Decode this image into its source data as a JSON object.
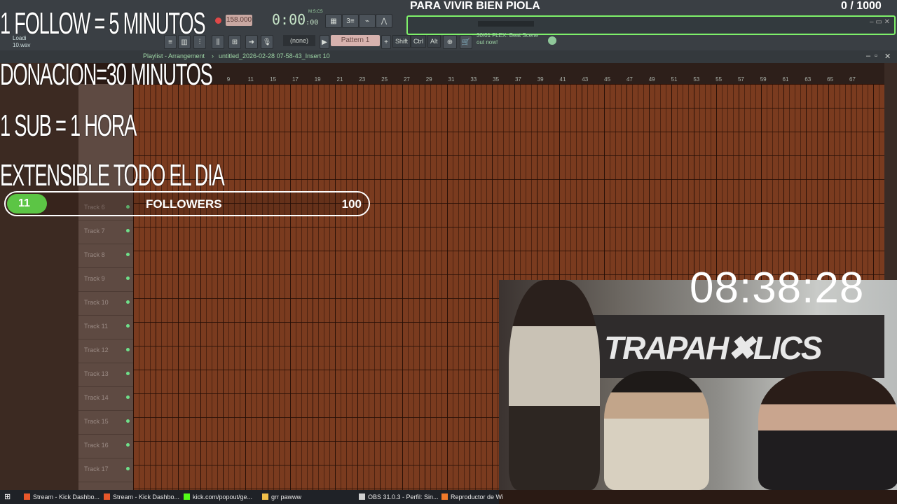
{
  "stream": {
    "title": "PARA VIVIR BIEN PIOLA",
    "counter": "0  / 1000",
    "overlay_lines": [
      "1 FOLLOW = 5 MINUTOS",
      "DONACION=30 MINUTOS",
      "1 SUB = 1 HORA",
      "EXTENSIBLE TODO EL DIA"
    ],
    "goal": {
      "current": "11",
      "label": "FOLLOWERS",
      "max": "100",
      "progress_fraction": 0.11
    },
    "clock": "08:38:28"
  },
  "fl": {
    "tempo": "158.000",
    "time": "0:00",
    "time_small": ":00",
    "time_unit": "M:S:CS",
    "pattern": "Pattern 1",
    "none_select": "(none)",
    "keys": [
      "Shift",
      "Ctrl",
      "Alt"
    ],
    "hint_line1": "30/01  FLEX: Beat Scene",
    "hint_line2": "out now!",
    "file_label": "Loadi",
    "file_label2": "10.wav",
    "playlist_crumb": "Playlist - Arrangement",
    "playlist_file": "untitled_2026-02-28 07-58-43_Insert 10",
    "ruler_ticks": [
      "9",
      "11",
      "15",
      "17",
      "19",
      "21",
      "23",
      "25",
      "27",
      "29",
      "31",
      "33",
      "35",
      "37",
      "39",
      "41",
      "43",
      "45",
      "47",
      "49",
      "51",
      "53",
      "55",
      "57",
      "59",
      "61",
      "63",
      "65",
      "67"
    ],
    "tracks": [
      "Track 6",
      "Track 7",
      "Track 8",
      "Track 9",
      "Track 10",
      "Track 11",
      "Track 12",
      "Track 13",
      "Track 14",
      "Track 15",
      "Track 16",
      "Track 17"
    ]
  },
  "taskbar": {
    "items": [
      {
        "label": "Stream - Kick Dashbo...",
        "icon": "brave-icon"
      },
      {
        "label": "Stream - Kick Dashbo...",
        "icon": "brave-icon"
      },
      {
        "label": "kick.com/popout/ge...",
        "icon": "kick-icon"
      },
      {
        "label": "grr pawww",
        "icon": "folder-icon"
      },
      {
        "label": "OBS 31.0.3 - Perfil: Sin...",
        "icon": "obs-icon"
      },
      {
        "label": "Reproductor de Wi",
        "icon": "media-player-icon"
      }
    ]
  }
}
